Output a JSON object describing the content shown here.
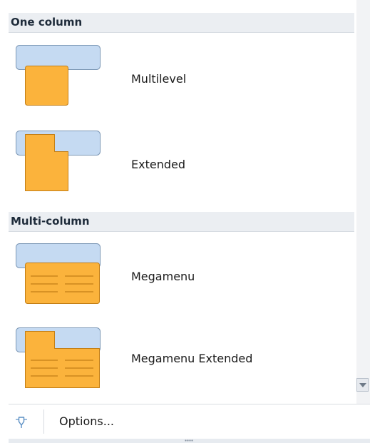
{
  "gallery": {
    "sections": [
      {
        "title": "One column",
        "items": [
          {
            "label": "Multilevel",
            "icon": "layout-multilevel-icon"
          },
          {
            "label": "Extended",
            "icon": "layout-extended-icon"
          }
        ]
      },
      {
        "title": "Multi-column",
        "items": [
          {
            "label": "Megamenu",
            "icon": "layout-megamenu-icon"
          },
          {
            "label": "Megamenu Extended",
            "icon": "layout-megamenu-extended-icon"
          }
        ]
      }
    ]
  },
  "footer": {
    "options_label": "Options...",
    "icon": "pushpin-icon"
  },
  "colors": {
    "header_bg": "#ebeef2",
    "bar_fill": "#c5daf2",
    "bar_stroke": "#7d98b6",
    "panel_fill": "#fbb33c",
    "panel_stroke": "#c37e15"
  }
}
